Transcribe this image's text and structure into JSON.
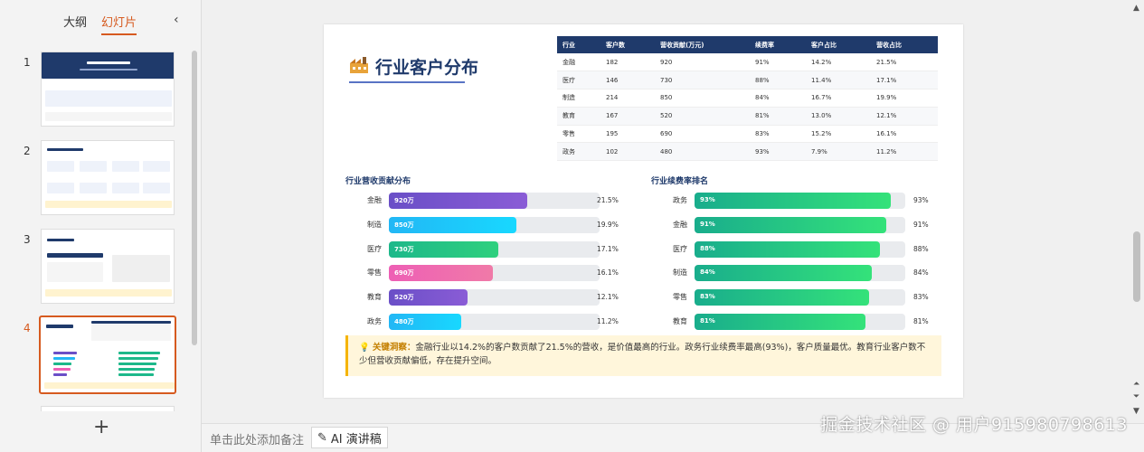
{
  "sidebar": {
    "tabs": [
      {
        "label": "大纲",
        "active": false
      },
      {
        "label": "幻灯片",
        "active": true
      }
    ],
    "slides": [
      {
        "number": "1"
      },
      {
        "number": "2"
      },
      {
        "number": "3"
      },
      {
        "number": "4",
        "active": true
      }
    ],
    "add_label": "+"
  },
  "bottom": {
    "notes_placeholder": "单击此处添加备注",
    "ai_label": "AI 演讲稿"
  },
  "watermark": "掘金技术社区 @ 用户915980798613",
  "slide": {
    "title": "行业客户分布",
    "table": {
      "headers": [
        "行业",
        "客户数",
        "营收贡献(万元)",
        "续费率",
        "客户占比",
        "营收占比"
      ],
      "rows": [
        [
          "金融",
          "182",
          "920",
          "91%",
          "14.2%",
          "21.5%"
        ],
        [
          "医疗",
          "146",
          "730",
          "88%",
          "11.4%",
          "17.1%"
        ],
        [
          "制造",
          "214",
          "850",
          "84%",
          "16.7%",
          "19.9%"
        ],
        [
          "教育",
          "167",
          "520",
          "81%",
          "13.0%",
          "12.1%"
        ],
        [
          "零售",
          "195",
          "690",
          "83%",
          "15.2%",
          "16.1%"
        ],
        [
          "政务",
          "102",
          "480",
          "93%",
          "7.9%",
          "11.2%"
        ]
      ]
    },
    "revenue_section_title": "行业营收贡献分布",
    "renewal_section_title": "行业续费率排名",
    "insight_label": "关键洞察：",
    "insight_text": "金融行业以14.2%的客户数贡献了21.5%的营收，是价值最高的行业。政务行业续费率最高(93%)，客户质量最优。教育行业客户数不少但营收贡献偏低，存在提升空间。"
  },
  "chart_data": [
    {
      "type": "bar",
      "title": "行业营收贡献分布",
      "categories": [
        "金融",
        "制造",
        "医疗",
        "零售",
        "教育",
        "政务"
      ],
      "series": [
        {
          "values": [
            920,
            850,
            730,
            690,
            520,
            480
          ]
        }
      ],
      "inner_labels": [
        "920万",
        "850万",
        "730万",
        "690万",
        "520万",
        "480万"
      ],
      "value_labels": [
        "21.5%",
        "19.9%",
        "17.1%",
        "16.1%",
        "12.1%",
        "11.2%"
      ],
      "colors": [
        "#6a4fc7",
        "#22b7f5",
        "#1db88a",
        "#ee5fb5",
        "#6a4fc7",
        "#22b7f5"
      ],
      "xlim": [
        0,
        1400
      ]
    },
    {
      "type": "bar",
      "title": "行业续费率排名",
      "categories": [
        "政务",
        "金融",
        "医疗",
        "制造",
        "零售",
        "教育"
      ],
      "series": [
        {
          "values": [
            93,
            91,
            88,
            84,
            83,
            81
          ]
        }
      ],
      "inner_labels": [
        "93%",
        "91%",
        "88%",
        "84%",
        "83%",
        "81%"
      ],
      "value_labels": [
        "93%",
        "91%",
        "88%",
        "84%",
        "83%",
        "81%"
      ],
      "colors": [
        "#1db88a"
      ],
      "xlim": [
        0,
        100
      ]
    }
  ]
}
